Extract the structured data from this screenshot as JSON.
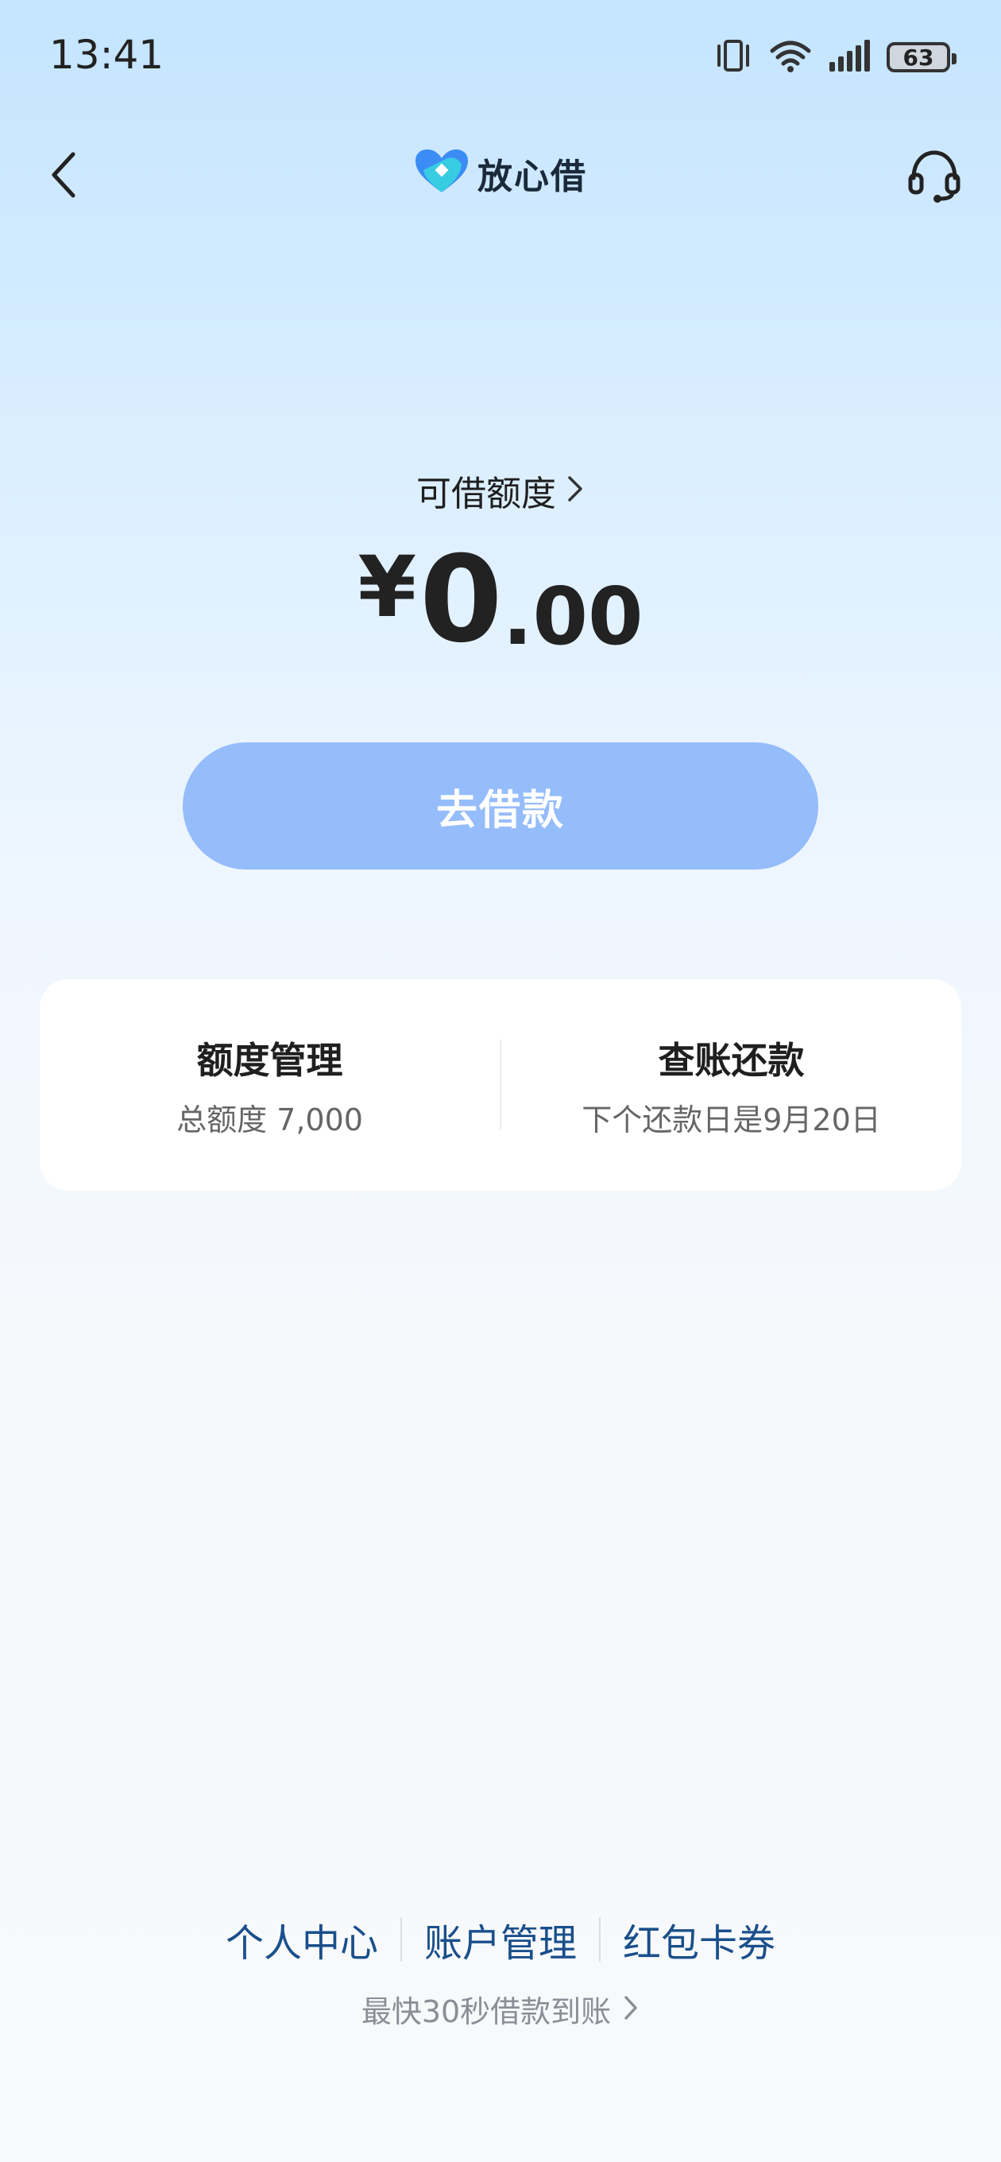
{
  "status_bar": {
    "time": "13:41",
    "battery": "63",
    "icons": [
      "vibrate-icon",
      "wifi-icon",
      "signal-icon",
      "battery-icon"
    ]
  },
  "header": {
    "brand_name": "放心借",
    "icons": [
      "back-arrow-icon",
      "brand-logo-icon",
      "headset-icon"
    ]
  },
  "credit": {
    "label": "可借额度",
    "currency": "¥",
    "amount_integer": "0",
    "amount_decimal": ".00"
  },
  "borrow_button": {
    "label": "去借款"
  },
  "card": {
    "left": {
      "title": "额度管理",
      "subtitle": "总额度 7,000"
    },
    "right": {
      "title": "查账还款",
      "subtitle": "下个还款日是9月20日"
    }
  },
  "bottom_links": [
    "个人中心",
    "账户管理",
    "红包卡券"
  ],
  "bottom_tip": "最快30秒借款到账",
  "colors": {
    "accent": "#95bcfb",
    "link": "#1a4f8b",
    "background_top": "#c4e4ff",
    "background_bottom": "#f7f9fb"
  }
}
